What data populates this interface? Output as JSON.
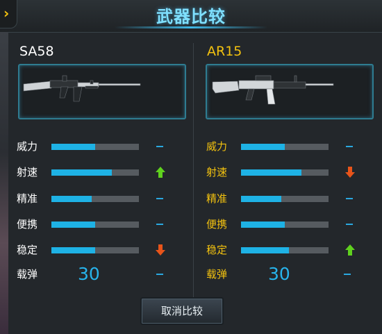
{
  "title": "武器比较",
  "back_icon": "chevron-right-icon",
  "left": {
    "name": "SA58",
    "name_color": "#ffffff",
    "label_color": "#ffffff",
    "stats": [
      {
        "label": "威力",
        "value": 0.5,
        "change": "none"
      },
      {
        "label": "射速",
        "value": 0.69,
        "change": "up"
      },
      {
        "label": "精准",
        "value": 0.46,
        "change": "none"
      },
      {
        "label": "便携",
        "value": 0.5,
        "change": "none"
      },
      {
        "label": "稳定",
        "value": 0.5,
        "change": "down"
      }
    ],
    "ammo_label": "载弹",
    "ammo_value": "30"
  },
  "right": {
    "name": "AR15",
    "name_color": "#f3c20f",
    "label_color": "#f3c20f",
    "stats": [
      {
        "label": "威力",
        "value": 0.5,
        "change": "none"
      },
      {
        "label": "射速",
        "value": 0.69,
        "change": "down"
      },
      {
        "label": "精准",
        "value": 0.46,
        "change": "none"
      },
      {
        "label": "便携",
        "value": 0.5,
        "change": "none"
      },
      {
        "label": "稳定",
        "value": 0.55,
        "change": "up"
      }
    ],
    "ammo_label": "载弹",
    "ammo_value": "30"
  },
  "cancel_button": "取消比较",
  "colors": {
    "bar_fill": "#1eb2e5",
    "bar_track": "#565b60",
    "arrow_up": "#5fd11e",
    "arrow_down": "#e8541a"
  }
}
